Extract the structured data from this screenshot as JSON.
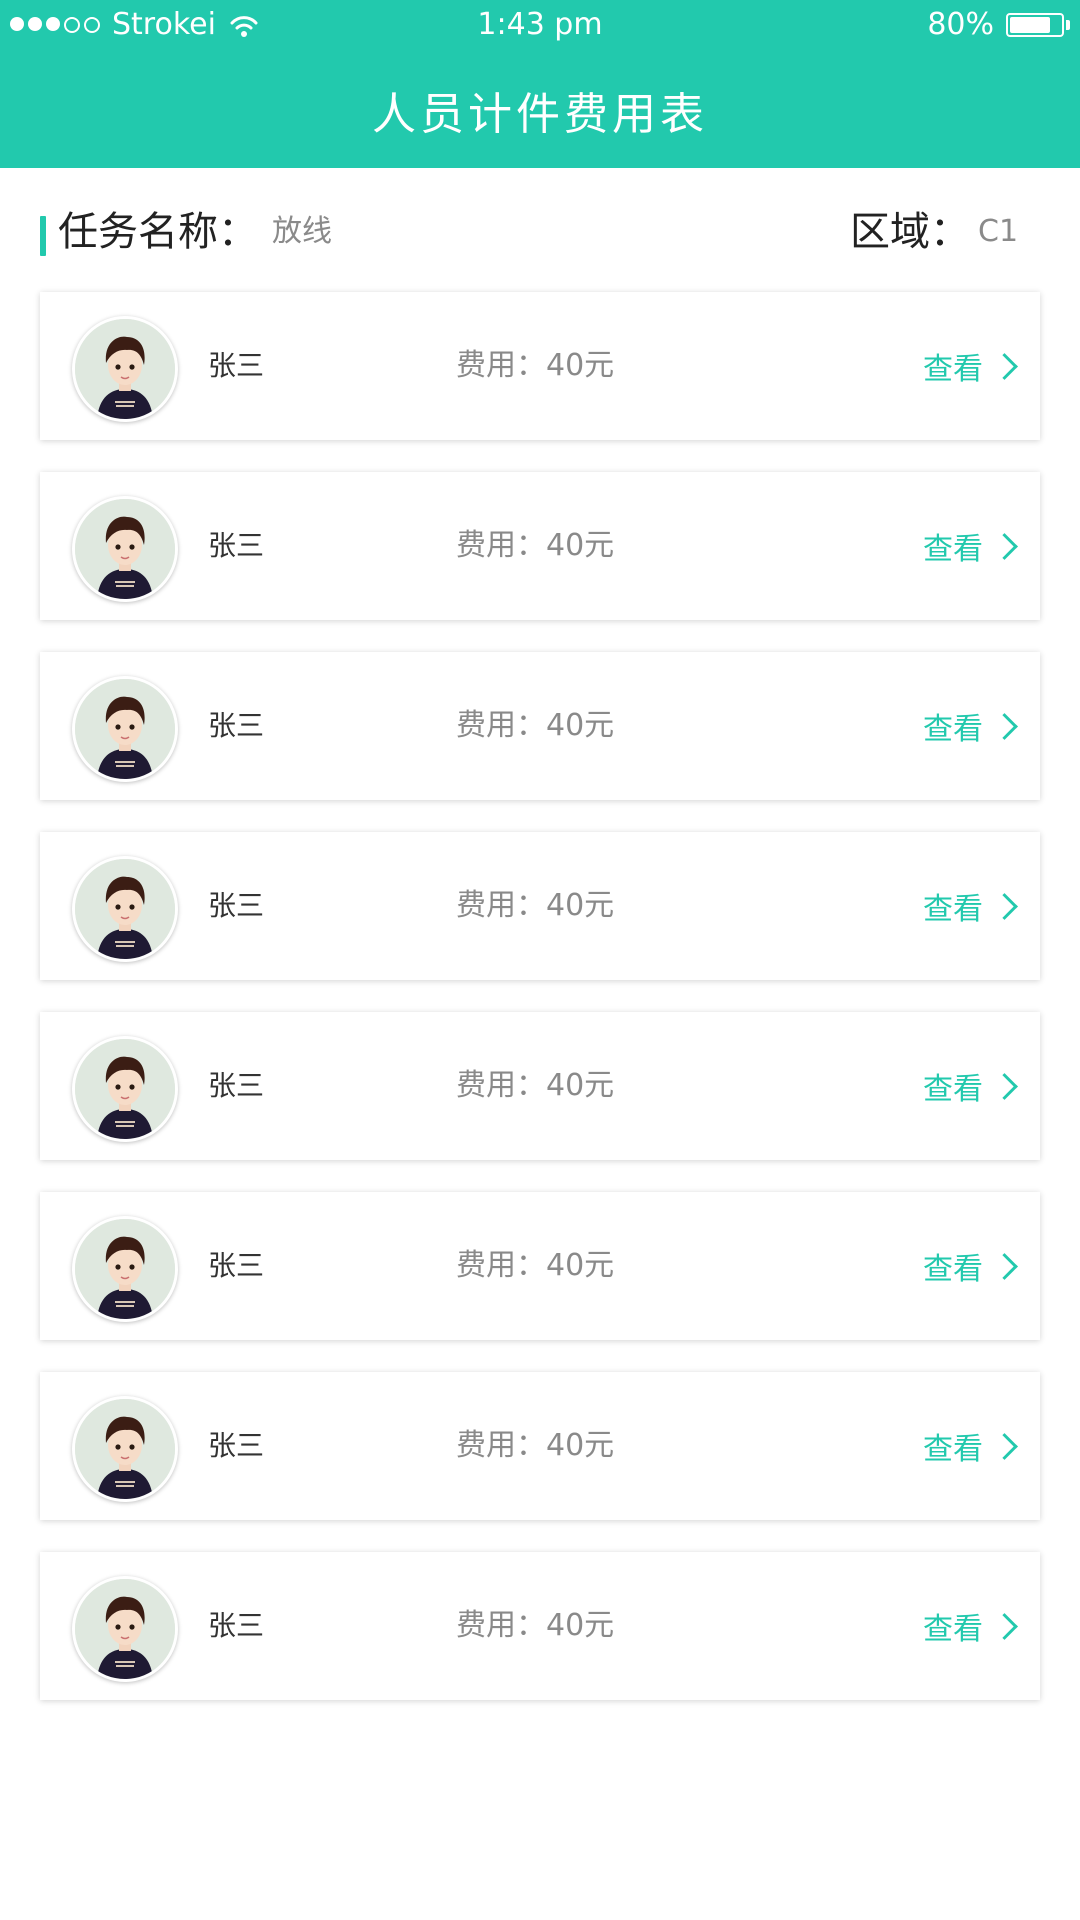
{
  "status_bar": {
    "carrier": "Strokei",
    "time": "1:43 pm",
    "battery": "80%",
    "battery_level": 0.8,
    "signal_bars": 3,
    "signal_total": 5
  },
  "header": {
    "title": "人员计件费用表",
    "color": "#22c9ad"
  },
  "info": {
    "task_label": "任务名称：",
    "task_value": "放线",
    "area_label": "区域：",
    "area_value": "C1"
  },
  "workers": [
    {
      "name": "张三",
      "fee": "费用：40元",
      "action": "查看"
    },
    {
      "name": "张三",
      "fee": "费用：40元",
      "action": "查看"
    },
    {
      "name": "张三",
      "fee": "费用：40元",
      "action": "查看"
    },
    {
      "name": "张三",
      "fee": "费用：40元",
      "action": "查看"
    },
    {
      "name": "张三",
      "fee": "费用：40元",
      "action": "查看"
    },
    {
      "name": "张三",
      "fee": "费用：40元",
      "action": "查看"
    },
    {
      "name": "张三",
      "fee": "费用：40元",
      "action": "查看"
    },
    {
      "name": "张三",
      "fee": "费用：40元",
      "action": "查看"
    }
  ],
  "icons": {
    "avatar": "avatar-icon",
    "chevron": "chevron-right-icon",
    "wifi": "wifi-icon",
    "battery": "battery-icon"
  }
}
